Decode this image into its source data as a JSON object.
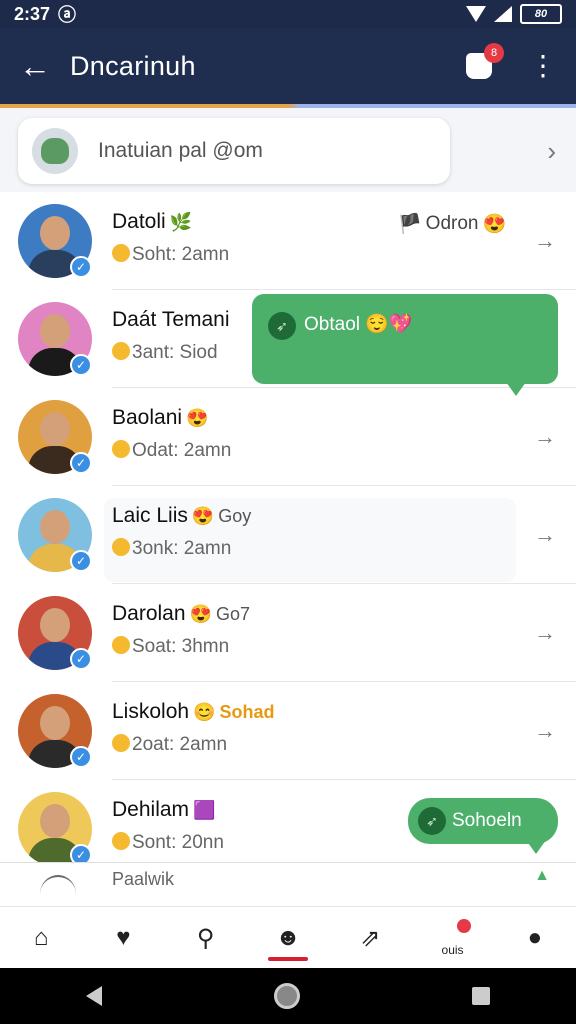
{
  "status": {
    "time": "2:37",
    "battery": "80"
  },
  "header": {
    "title": "Dncarinuh",
    "notification_count": "8"
  },
  "invite": {
    "text": "Inatuian pal @om"
  },
  "contacts": [
    {
      "name": "Datoli",
      "emoji": "🌿",
      "extra": "",
      "sub": "Soht: 2amn",
      "right": "Odron",
      "avatar_bg": "#3d7bc2",
      "shirt": "#2a3e5e"
    },
    {
      "name": "Daát Temani",
      "emoji": "",
      "extra": "",
      "sub": "3ant: Siod",
      "right": "",
      "avatar_bg": "#e084c4",
      "shirt": "#1a1a1a"
    },
    {
      "name": "Baolani",
      "emoji": "😍",
      "extra": "",
      "sub": "Odat: 2amn",
      "right": "",
      "avatar_bg": "#e0a040",
      "shirt": "#3b2a1e"
    },
    {
      "name": "Laic Liis",
      "emoji": "😍",
      "extra": "Goy",
      "sub": "3onk: 2amn",
      "right": "",
      "avatar_bg": "#7fc0e0",
      "shirt": "#e6b84a"
    },
    {
      "name": "Darolan",
      "emoji": "😍",
      "extra": "Go7",
      "sub": "Soat: 3hmn",
      "right": "",
      "avatar_bg": "#c94e3b",
      "shirt": "#2b4a8a"
    },
    {
      "name": "Liskoloh",
      "emoji": "😊",
      "extra": "Sohad",
      "sub": "2oat: 2amn",
      "right": "",
      "avatar_bg": "#c4612d",
      "shirt": "#2a2a2a"
    },
    {
      "name": "Dehilam",
      "emoji": "🟪",
      "extra": "",
      "sub": "Sont: 20nn",
      "right": "",
      "avatar_bg": "#efc85a",
      "shirt": "#4f6a2d"
    }
  ],
  "bubbles": {
    "first": "Obtaol 😌💖",
    "second": "Sohoeln"
  },
  "partial": {
    "text": "Paalwik"
  },
  "nav": {
    "notif_label": "ouis"
  }
}
